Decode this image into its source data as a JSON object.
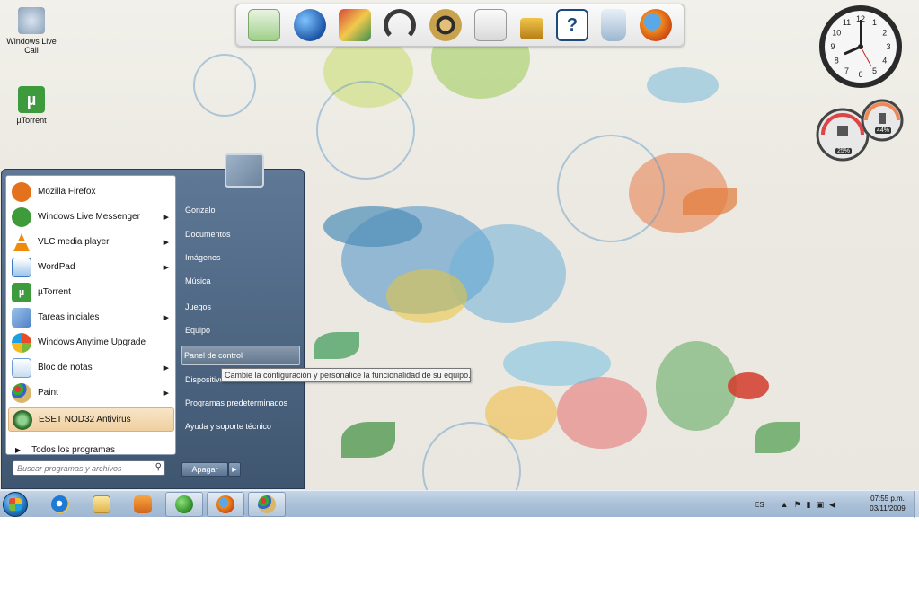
{
  "desktop": {
    "icons": [
      {
        "label": "Windows Live Call",
        "icon": "phone-icon"
      },
      {
        "label": "µTorrent",
        "icon": "utorrent-icon"
      }
    ]
  },
  "dock": {
    "items": [
      "mail-icon",
      "globe-icon",
      "photo-icon",
      "headphones-icon",
      "film-reel-icon",
      "notepad-icon",
      "padlock-icon",
      "help-icon",
      "recycle-bin-icon",
      "firefox-icon"
    ],
    "help_glyph": "?"
  },
  "gadgets": {
    "clock": {
      "numbers": [
        "12",
        "1",
        "2",
        "3",
        "4",
        "5",
        "6",
        "7",
        "8",
        "9",
        "10",
        "11"
      ]
    },
    "cpu_meter": {
      "cpu_percent": "25%",
      "memory_percent": "44%"
    }
  },
  "start_menu": {
    "programs": [
      {
        "label": "Mozilla Firefox",
        "icon": "firefox-icon",
        "color": "#e4711c",
        "submenu": false
      },
      {
        "label": "Windows Live Messenger",
        "icon": "messenger-icon",
        "color": "#3f9b3a",
        "submenu": true
      },
      {
        "label": "VLC media player",
        "icon": "vlc-cone-icon",
        "color": "#f08a0b",
        "submenu": true
      },
      {
        "label": "WordPad",
        "icon": "wordpad-icon",
        "color": "#3a78c9",
        "submenu": true
      },
      {
        "label": "µTorrent",
        "icon": "utorrent-icon",
        "color": "#3d9a3d",
        "submenu": false
      },
      {
        "label": "Tareas iniciales",
        "icon": "getting-started-icon",
        "color": "#5f8fd0",
        "submenu": true
      },
      {
        "label": "Windows Anytime Upgrade",
        "icon": "windows-flag-icon",
        "color": "#2f77c5",
        "submenu": false
      },
      {
        "label": "Bloc de notas",
        "icon": "notepad-icon",
        "color": "#6a9bd6",
        "submenu": true
      },
      {
        "label": "Paint",
        "icon": "paint-palette-icon",
        "color": "#c9a14a",
        "submenu": true
      },
      {
        "label": "ESET NOD32 Antivirus",
        "icon": "eset-icon",
        "color": "#3b7d3b",
        "submenu": false
      }
    ],
    "all_programs": "Todos los programas",
    "search_placeholder": "Buscar programas y archivos",
    "right_items": [
      "Gonzalo",
      "Documentos",
      "Imágenes",
      "Música",
      "Juegos",
      "Equipo",
      "Panel de control",
      "Dispositivos",
      "Programas predeterminados",
      "Ayuda y soporte técnico"
    ],
    "shutdown_label": "Apagar",
    "tooltip": "Cambie la configuración y personalice la funcionalidad de su equipo."
  },
  "taskbar": {
    "pinned": [
      "internet-explorer-icon",
      "folder-icon",
      "media-player-icon",
      "messenger-icon",
      "firefox-icon",
      "paint-icon"
    ],
    "language": "ES",
    "time": "07:55 p.m.",
    "date": "03/11/2009"
  },
  "colors": {
    "taskbar": "#aac0d8",
    "start_menu": "#4f6782",
    "highlight": "#f0cf9f"
  }
}
